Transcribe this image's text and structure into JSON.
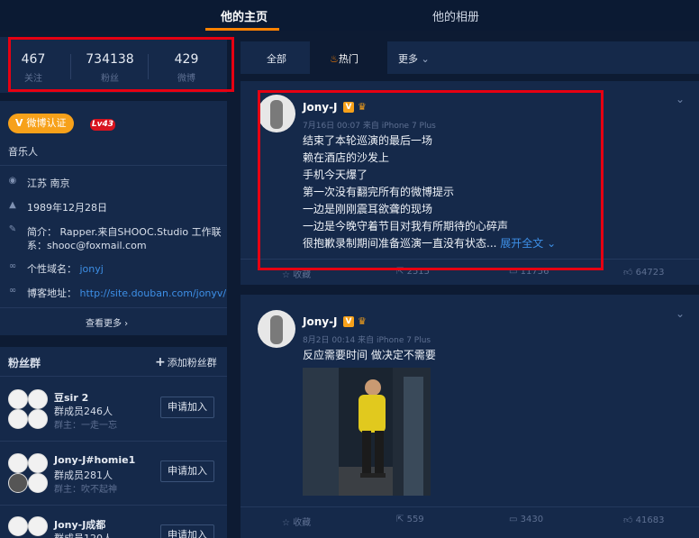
{
  "nav": {
    "tab_home": "他的主页",
    "tab_album": "他的相册"
  },
  "stats": [
    {
      "num": "467",
      "label": "关注"
    },
    {
      "num": "734138",
      "label": "粉丝"
    },
    {
      "num": "429",
      "label": "微博"
    }
  ],
  "profile": {
    "verify_label": "微博认证",
    "level": "Lv43",
    "title": "音乐人",
    "location": "江苏 南京",
    "birthday": "1989年12月28日",
    "intro_line1": "简介： Rapper.来自SHOOC.Studio 工作联",
    "intro_line2": "系：shooc@foxmail.com",
    "domain_label": "个性域名：",
    "domain_value": "jonyj",
    "blog_label": "博客地址：",
    "blog_value": "http://site.douban.com/jonyv/",
    "see_more": "查看更多 ›"
  },
  "fans": {
    "header": "粉丝群",
    "add_label": "添加粉丝群",
    "join_label": "申请加入",
    "groups": [
      {
        "name": "豆sir 2",
        "count": "群成员246人",
        "owner": "群主：一走一忘"
      },
      {
        "name": "Jony-J#homie1",
        "count": "群成员281人",
        "owner": "群主：吹不起神"
      },
      {
        "name": "Jony-J成都",
        "count": "群成员120人"
      }
    ]
  },
  "feed_tabs": {
    "all": "全部",
    "hot": "热门",
    "more": "更多"
  },
  "posts": [
    {
      "user": "Jony-J",
      "meta": "7月16日 00:07 来自 iPhone 7 Plus",
      "lines": [
        "结束了本轮巡演的最后一场",
        "赖在酒店的沙发上",
        "手机今天爆了",
        "第一次没有翻完所有的微博提示",
        "一边是刚刚震耳欲聋的现场",
        "一边是今晚守着节目对我有所期待的心碎声",
        "很抱歉录制期间准备巡演一直没有状态..."
      ],
      "expand": "展开全文",
      "actions": {
        "fav": "收藏",
        "repost": "2515",
        "comment": "11756",
        "like": "64723"
      }
    },
    {
      "user": "Jony-J",
      "meta": "8月2日 00:14 来自 iPhone 7 Plus",
      "lines": [
        "反应需要时间 做决定不需要"
      ],
      "actions": {
        "fav": "收藏",
        "repost": "559",
        "comment": "3430",
        "like": "41683"
      }
    }
  ],
  "colors": {
    "accent": "#ff8200",
    "highlight": "#e60012",
    "link": "#3d8fe6"
  }
}
